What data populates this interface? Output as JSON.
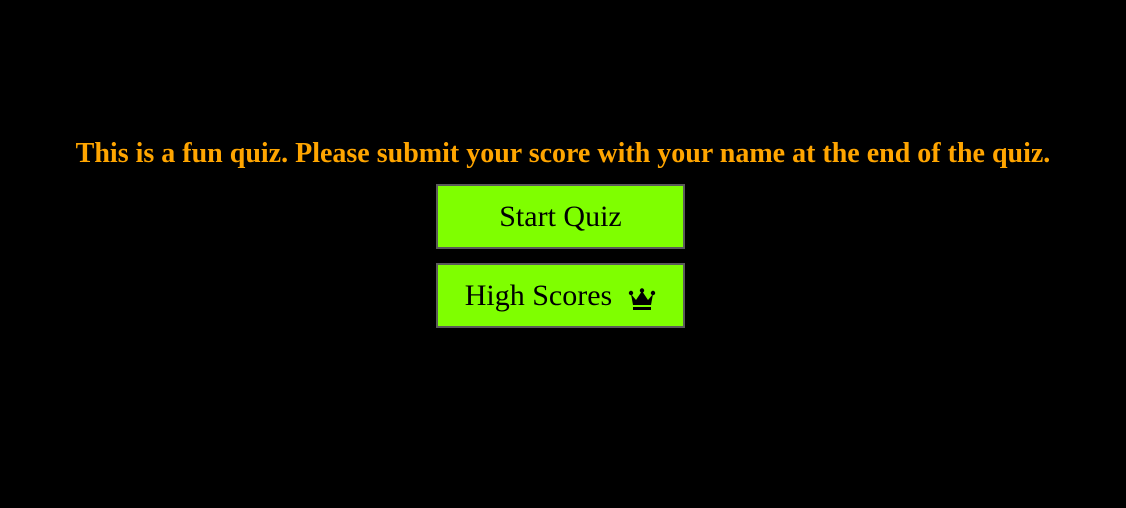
{
  "intro": {
    "text": "This is a fun quiz. Please submit your score with your name at the end of the quiz."
  },
  "buttons": {
    "start_label": "Start Quiz",
    "high_scores_label": "High Scores",
    "high_scores_icon": "crown-icon"
  },
  "colors": {
    "background": "#000000",
    "intro_text": "#ffa500",
    "button_bg": "#7fff00",
    "button_text": "#000000"
  }
}
